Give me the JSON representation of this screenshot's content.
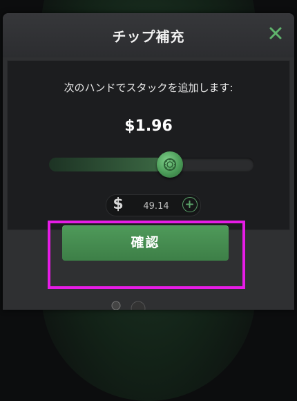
{
  "dialog": {
    "title": "チップ補充",
    "message": "次のハンドでスタックを追加します:",
    "amount": "$1.96",
    "currency_symbol": "$",
    "input_value": "49.14",
    "slider_fraction": 0.59,
    "confirm_label": "確認"
  },
  "colors": {
    "accent_green": "#4f9a5a",
    "highlight_magenta": "#e61ce6",
    "close_green": "#5fb36c"
  },
  "icons": {
    "close": "close-icon",
    "plus": "plus-icon",
    "knob": "poker-chip-icon"
  }
}
